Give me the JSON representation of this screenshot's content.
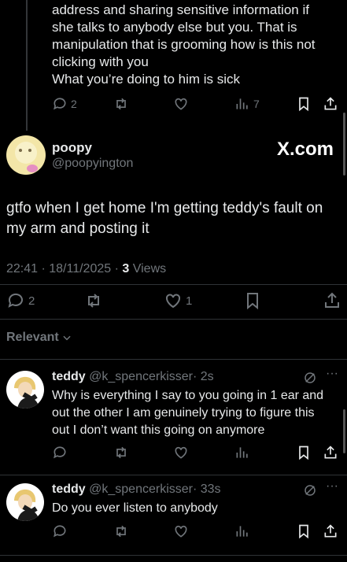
{
  "parent_tweet": {
    "text_lines": [
      "address and sharing sensitive information if",
      "she talks to anybody else but you. That is",
      "manipulation that is grooming how is this not",
      "clicking with you",
      "What you’re doing to him is sick"
    ],
    "replies": "2",
    "views": "7"
  },
  "main_tweet": {
    "display_name": "poopy",
    "handle": "@poopyington",
    "watermark": "X.com",
    "text_lines": [
      "gtfo when I get home I'm getting teddy's fault on",
      "my arm and posting it"
    ],
    "time": "22:41 · 18/11/2025 · ",
    "views_count": "3",
    "views_label": " Views",
    "replies": "2",
    "likes": "1"
  },
  "sort": {
    "label": "Relevant"
  },
  "replies": [
    {
      "display_name": "teddy",
      "handle": "@k_spencerkisser",
      "time": "· 2s",
      "text_lines": [
        "Why is everything I say to you going in 1 ear and",
        "out the other I am genuinely trying to figure this",
        "out I don’t want this going on anymore"
      ]
    },
    {
      "display_name": "teddy",
      "handle": "@k_spencerkisser",
      "time": "· 33s",
      "text_lines": [
        "Do you ever listen to anybody"
      ]
    }
  ],
  "icons": {
    "reply": "reply-icon",
    "repost": "repost-icon",
    "like": "heart-icon",
    "views": "views-icon",
    "bookmark": "bookmark-icon",
    "share": "share-icon",
    "grok": "grok-icon",
    "more": "more-icon"
  },
  "colors": {
    "background": "#000000",
    "text": "#e7e9ea",
    "muted": "#71767b",
    "divider": "#2f3336"
  }
}
